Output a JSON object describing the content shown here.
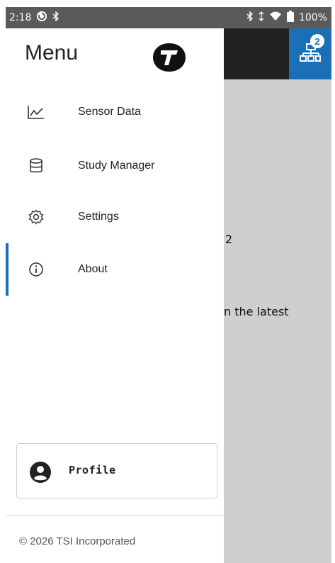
{
  "status_bar": {
    "time": "2:18",
    "battery": "100%",
    "icons": [
      "sync-icon",
      "bluetooth-icon",
      "bluetooth-icon",
      "signal-icon",
      "wifi-icon",
      "battery-icon"
    ]
  },
  "background_app": {
    "notification_count": "2",
    "text_fragment_1": "2",
    "text_fragment_2": "n the latest"
  },
  "drawer": {
    "title": "Menu",
    "logo_text": "TSI",
    "items": [
      {
        "label": "Sensor Data",
        "icon": "chart-line-icon",
        "active": false
      },
      {
        "label": "Study Manager",
        "icon": "database-icon",
        "active": false
      },
      {
        "label": "Settings",
        "icon": "gear-icon",
        "active": false
      },
      {
        "label": "About",
        "icon": "info-icon",
        "active": true
      }
    ],
    "profile_label": "Profile",
    "copyright": "© 2026 TSI Incorporated"
  },
  "colors": {
    "accent": "#1b6fb6",
    "overlay": "#cfcfcf",
    "status_bar": "#5a5a5a"
  }
}
